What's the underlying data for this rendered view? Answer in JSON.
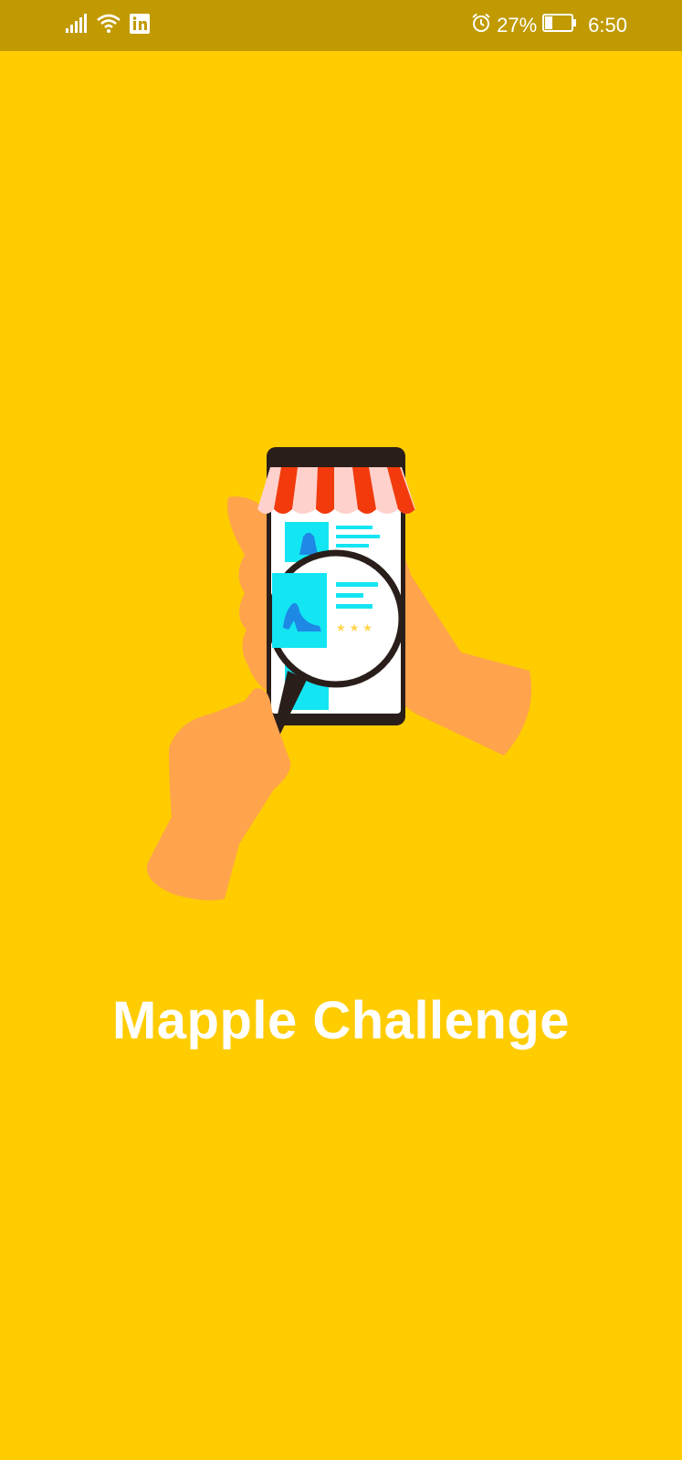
{
  "status_bar": {
    "icons": [
      "cellular-signal-icon",
      "wifi-icon",
      "linkedin-icon",
      "alarm-icon",
      "battery-icon"
    ],
    "battery_percent": "27%",
    "battery_level": 0.27,
    "time": "6:50"
  },
  "splash": {
    "illustration": "shopping-app-search-illustration",
    "title": "Mapple Challenge"
  },
  "colors": {
    "background": "#FFCC00",
    "status_bar": "#C09A00",
    "hand": "#FFA34D",
    "awning_red": "#F23A0C",
    "awning_pink": "#FFD1CC",
    "screen_accent": "#13E5F2",
    "product_blue": "#1E88E5",
    "dark": "#2A1E1A"
  }
}
